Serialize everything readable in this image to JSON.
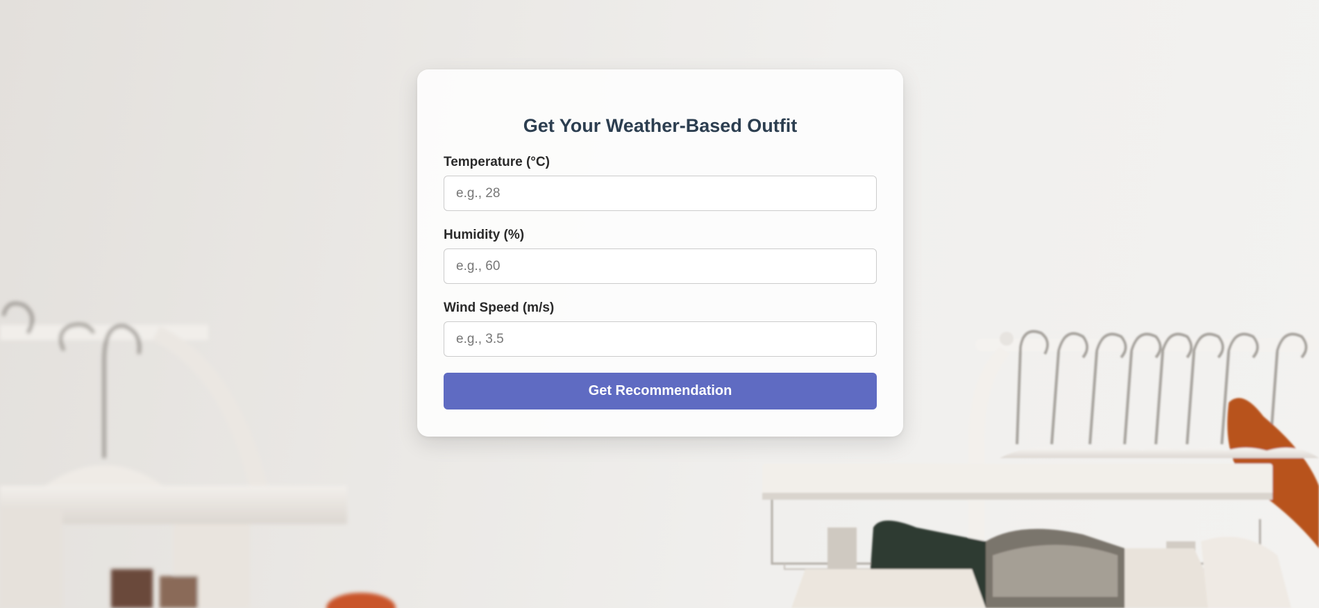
{
  "form": {
    "title": "Get Your Weather-Based Outfit",
    "fields": [
      {
        "label": "Temperature (°C)",
        "placeholder": "e.g., 28",
        "value": ""
      },
      {
        "label": "Humidity (%)",
        "placeholder": "e.g., 60",
        "value": ""
      },
      {
        "label": "Wind Speed (m/s)",
        "placeholder": "e.g., 3.5",
        "value": ""
      }
    ],
    "submit_label": "Get Recommendation"
  },
  "theme": {
    "accent": "#5f6bc2",
    "title_color": "#2c3e50",
    "card_background": "#fcfcfc"
  },
  "background": {
    "icon": "clothing-rack-photo"
  }
}
